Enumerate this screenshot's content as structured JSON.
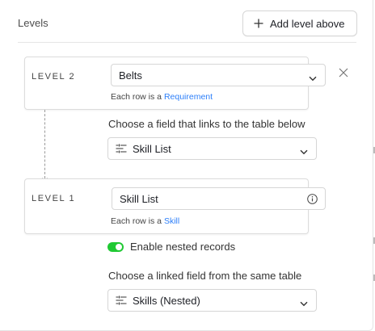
{
  "panel": {
    "title": "Levels",
    "add_level_label": "Add level above"
  },
  "level2": {
    "tag": "LEVEL 2",
    "table_value": "Belts",
    "row_prefix": "Each row is a ",
    "row_link": "Requirement"
  },
  "link_field": {
    "label": "Choose a field that links to the table below",
    "value": "Skill List"
  },
  "level1": {
    "tag": "LEVEL 1",
    "name_value": "Skill List",
    "row_prefix": "Each row is a ",
    "row_link": "Skill"
  },
  "nested": {
    "enabled": true,
    "label": "Enable nested records"
  },
  "linked_field": {
    "label": "Choose a linked field from the same table",
    "value": "Skills (Nested)"
  },
  "colors": {
    "accent": "#2d7ff9",
    "toggle_on": "#20c933"
  }
}
